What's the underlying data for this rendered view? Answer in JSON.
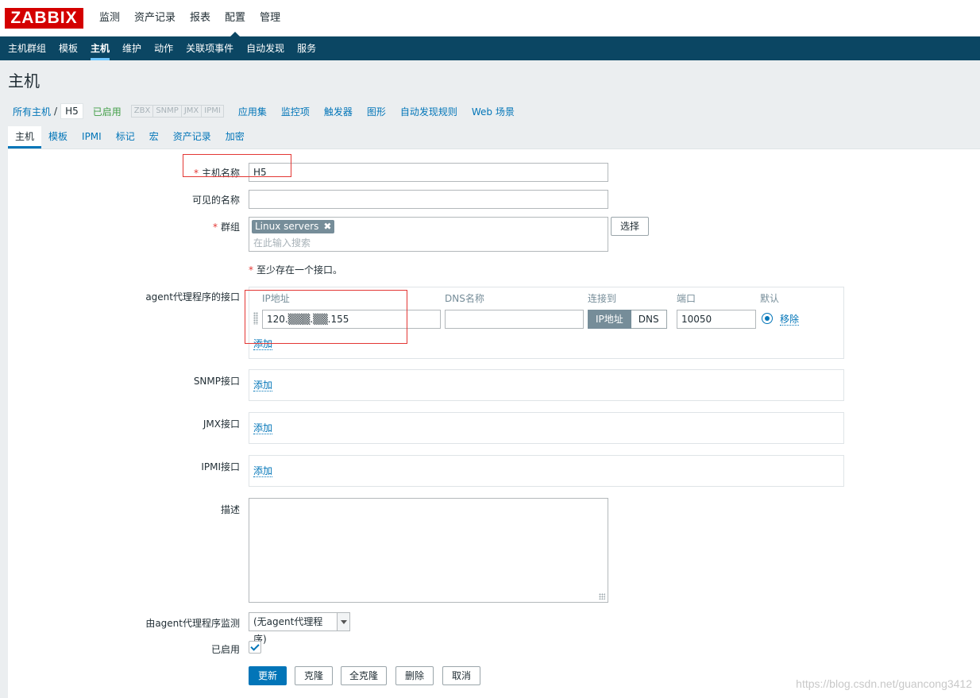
{
  "logo": "ZABBIX",
  "top_menu": [
    "监测",
    "资产记录",
    "报表",
    "配置",
    "管理"
  ],
  "sub_menu": [
    "主机群组",
    "模板",
    "主机",
    "维护",
    "动作",
    "关联项事件",
    "自动发现",
    "服务"
  ],
  "page_title": "主机",
  "breadcrumbs": {
    "all_hosts": "所有主机",
    "separator": "/",
    "current": "H5",
    "status": "已启用",
    "availability": [
      "ZBX",
      "SNMP",
      "JMX",
      "IPMI"
    ],
    "nav": [
      "应用集",
      "监控项",
      "触发器",
      "图形",
      "自动发现规则",
      "Web 场景"
    ]
  },
  "tabs": [
    "主机",
    "模板",
    "IPMI",
    "标记",
    "宏",
    "资产记录",
    "加密"
  ],
  "form": {
    "host_name_label": "主机名称",
    "host_name_value": "H5",
    "visible_name_label": "可见的名称",
    "visible_name_value": "",
    "groups_label": "群组",
    "group_tag": "Linux servers",
    "group_tag_remove": "✖",
    "group_search_placeholder": "在此输入搜索",
    "select_button": "选择",
    "interface_warning": "至少存在一个接口。",
    "agent_interface_label": "agent代理程序的接口",
    "iface_headers": {
      "ip": "IP地址",
      "dns": "DNS名称",
      "connect": "连接到",
      "port": "端口",
      "default": "默认"
    },
    "agent_ip": "120.▒▒▒.▒▒.155",
    "agent_dns": "",
    "connect_ip": "IP地址",
    "connect_dns": "DNS",
    "agent_port": "10050",
    "remove_link": "移除",
    "add_link": "添加",
    "snmp_label": "SNMP接口",
    "jmx_label": "JMX接口",
    "ipmi_label": "IPMI接口",
    "description_label": "描述",
    "description_value": "",
    "proxy_label": "由agent代理程序监测",
    "proxy_value": "(无agent代理程序)",
    "enabled_label": "已启用",
    "enabled": true,
    "buttons": {
      "update": "更新",
      "clone": "克隆",
      "full_clone": "全克隆",
      "delete": "删除",
      "cancel": "取消"
    }
  },
  "watermark": "https://blog.csdn.net/guancong3412",
  "colors": {
    "brand": "#d40000",
    "nav_bg": "#0b4663",
    "link": "#0275b8",
    "enabled": "#429e47",
    "required": "#e33734"
  }
}
